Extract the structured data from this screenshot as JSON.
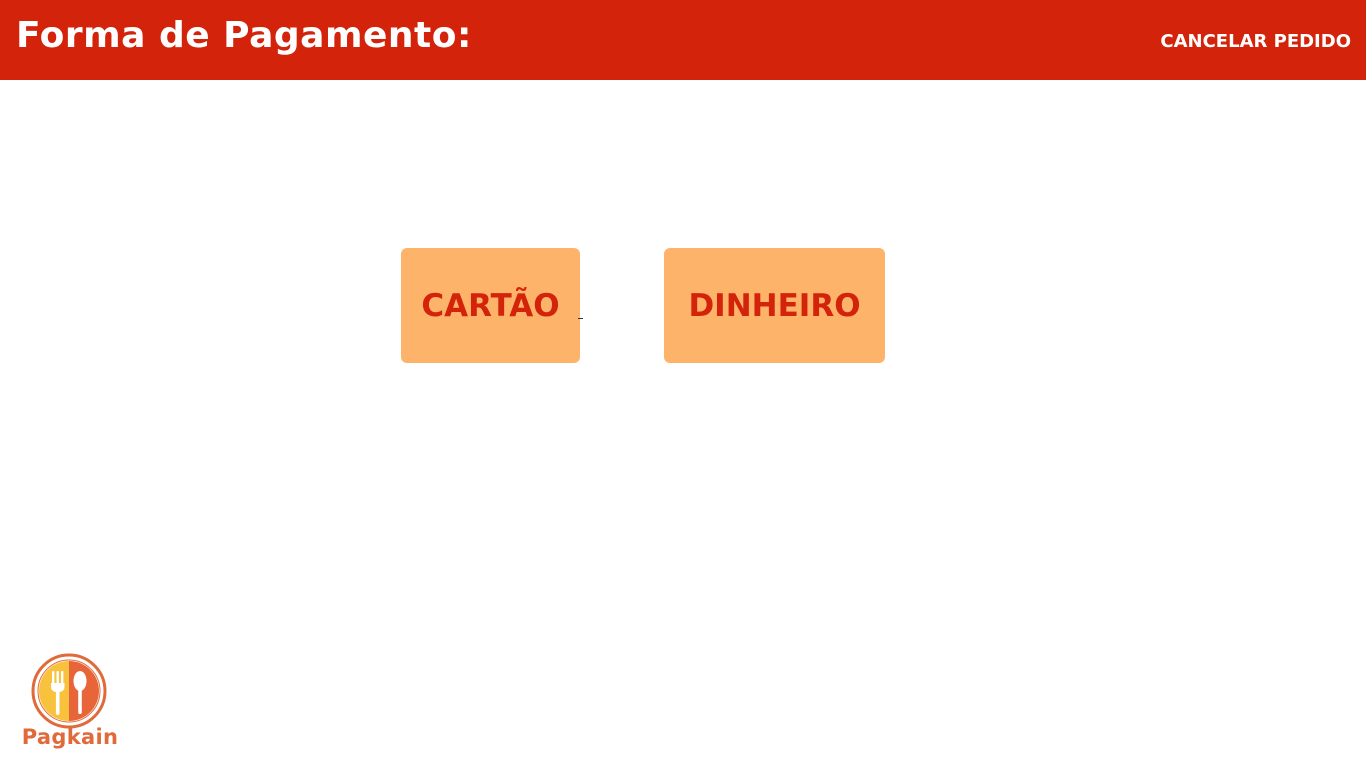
{
  "header": {
    "title": "Forma de Pagamento:",
    "cancel_label": "CANCELAR PEDIDO"
  },
  "payment_options": [
    {
      "label": "CARTÃO"
    },
    {
      "label": "DINHEIRO"
    }
  ],
  "logo": {
    "text": "Pagkain",
    "icon": "fork-spoon-icon"
  },
  "colors": {
    "header_background": "#d3230a",
    "button_background": "#feb36a",
    "button_text": "#d3230a",
    "header_text": "#ffffff",
    "logo_orange": "#e06a3a",
    "logo_yellow": "#f9c23c"
  }
}
